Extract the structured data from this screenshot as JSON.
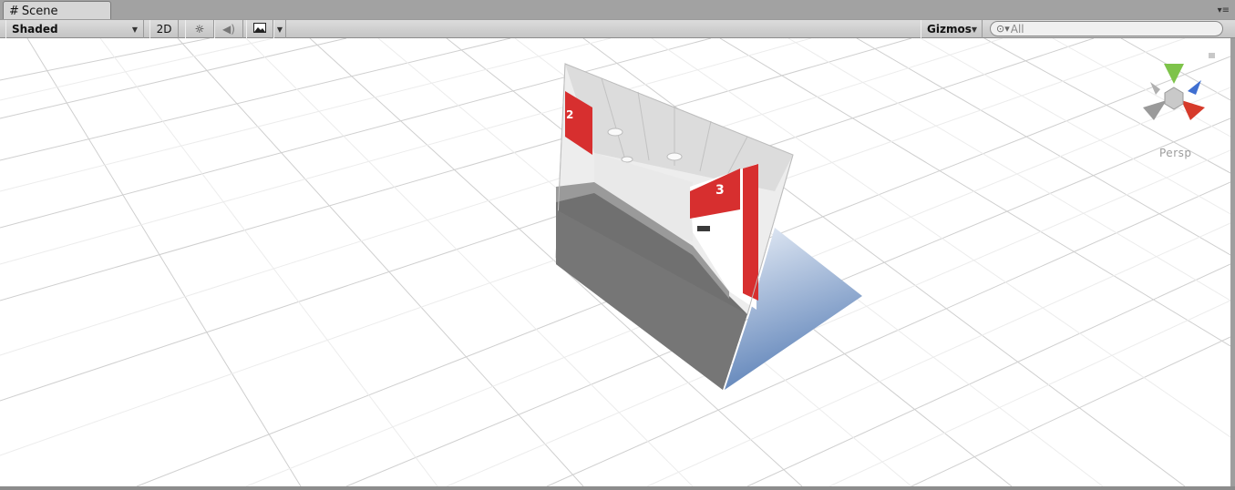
{
  "tab": {
    "icon": "grid-hash-icon",
    "label": "Scene"
  },
  "toolbar": {
    "draw_mode": "Shaded",
    "mode_2d": "2D",
    "lighting_icon": "sun-icon",
    "audio_icon": "speaker-icon",
    "effects_icon": "image-icon",
    "gizmos_label": "Gizmos",
    "search_placeholder": "All"
  },
  "viewport": {
    "projection_label": "Persp",
    "background": "#ffffff",
    "gizmo_colors": {
      "y": "#7ec34a",
      "x": "#d63a2a",
      "z": "#3f6fd1",
      "neutral": "#9a9a9a"
    }
  }
}
